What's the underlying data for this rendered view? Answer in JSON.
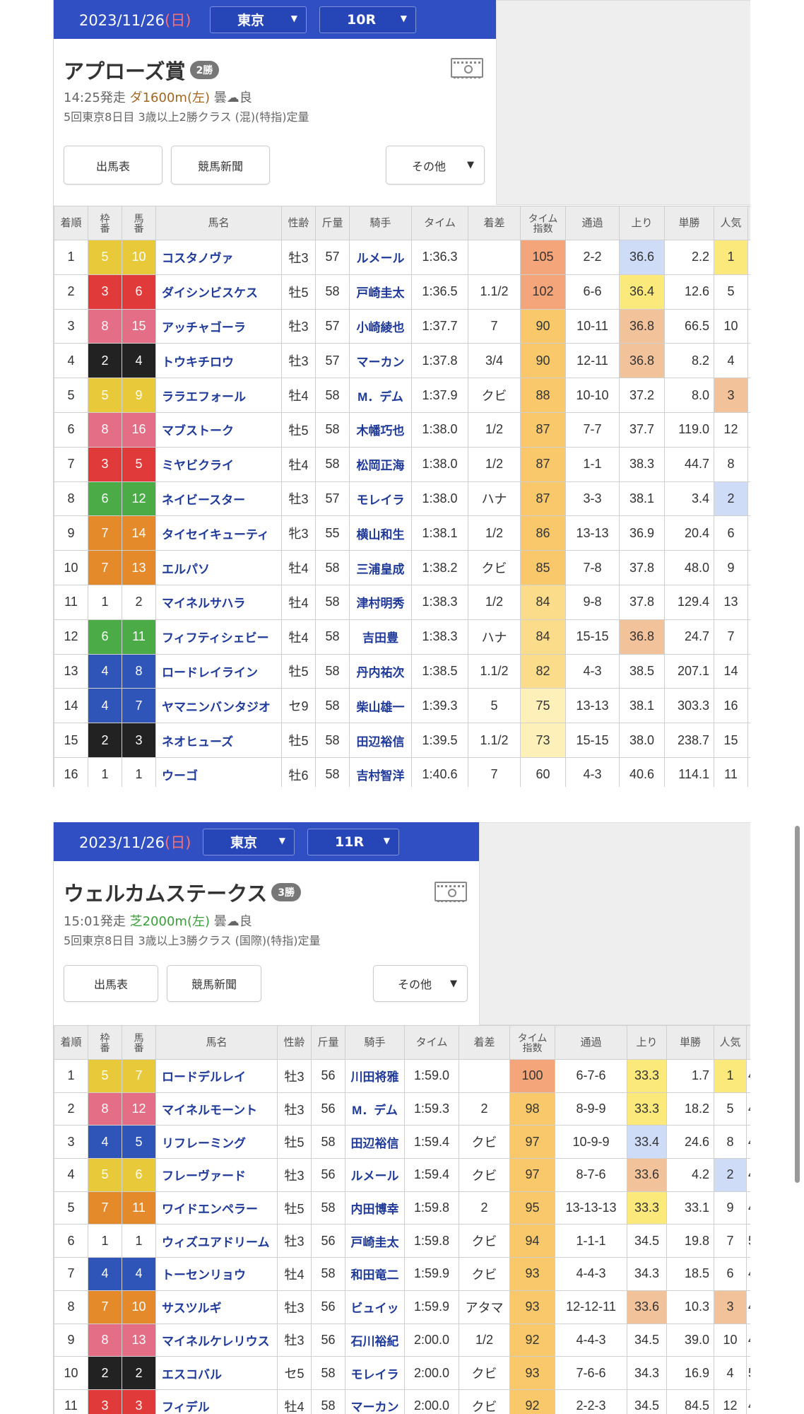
{
  "races": [
    {
      "date": "2023/11/26",
      "dow": "(日)",
      "venue": "東京",
      "race_no": "10R",
      "title": "アプローズ賞",
      "class_badge": "2勝",
      "start": "14:25発走",
      "course": "ダ1600m(左)",
      "surface": "dirt",
      "weather": "曇",
      "track": "良",
      "details": "5回東京8日目 3歳以上2勝クラス (混)(特指)定量",
      "buttons": {
        "entries": "出馬表",
        "newspaper": "競馬新聞",
        "other": "その他"
      },
      "headers": [
        "着順",
        "枠番",
        "馬番",
        "馬名",
        "性齢",
        "斤量",
        "騎手",
        "タイム",
        "着差",
        "タイム指数",
        "通過",
        "上り",
        "単勝",
        "人気"
      ],
      "rows": [
        [
          "1",
          "5",
          "10",
          "コスタノヴァ",
          "牡3",
          "57",
          "ルメール",
          "1:36.3",
          "",
          "105",
          "2-2",
          "36.6",
          "2.2",
          "1"
        ],
        [
          "2",
          "3",
          "6",
          "ダイシンビスケス",
          "牡5",
          "58",
          "戸崎圭太",
          "1:36.5",
          "1.1/2",
          "102",
          "6-6",
          "36.4",
          "12.6",
          "5"
        ],
        [
          "3",
          "8",
          "15",
          "アッチャゴーラ",
          "牡3",
          "57",
          "小崎綾也",
          "1:37.7",
          "7",
          "90",
          "10-11",
          "36.8",
          "66.5",
          "10"
        ],
        [
          "4",
          "2",
          "4",
          "トウキチロウ",
          "牡3",
          "57",
          "マーカン",
          "1:37.8",
          "3/4",
          "90",
          "12-11",
          "36.8",
          "8.2",
          "4"
        ],
        [
          "5",
          "5",
          "9",
          "ララエフォール",
          "牡4",
          "58",
          "M．デム",
          "1:37.9",
          "クビ",
          "88",
          "10-10",
          "37.2",
          "8.0",
          "3"
        ],
        [
          "6",
          "8",
          "16",
          "マブストーク",
          "牡5",
          "58",
          "木幡巧也",
          "1:38.0",
          "1/2",
          "87",
          "7-7",
          "37.7",
          "119.0",
          "12"
        ],
        [
          "7",
          "3",
          "5",
          "ミヤビクライ",
          "牡4",
          "58",
          "松岡正海",
          "1:38.0",
          "1/2",
          "87",
          "1-1",
          "38.3",
          "44.7",
          "8"
        ],
        [
          "8",
          "6",
          "12",
          "ネイビースター",
          "牡3",
          "57",
          "モレイラ",
          "1:38.0",
          "ハナ",
          "87",
          "3-3",
          "38.1",
          "3.4",
          "2"
        ],
        [
          "9",
          "7",
          "14",
          "タイセイキューティ",
          "牝3",
          "55",
          "横山和生",
          "1:38.1",
          "1/2",
          "86",
          "13-13",
          "36.9",
          "20.4",
          "6"
        ],
        [
          "10",
          "7",
          "13",
          "エルパソ",
          "牡4",
          "58",
          "三浦皇成",
          "1:38.2",
          "クビ",
          "85",
          "7-8",
          "37.8",
          "48.0",
          "9"
        ],
        [
          "11",
          "1",
          "2",
          "マイネルサハラ",
          "牡4",
          "58",
          "津村明秀",
          "1:38.3",
          "1/2",
          "84",
          "9-8",
          "37.8",
          "129.4",
          "13"
        ],
        [
          "12",
          "6",
          "11",
          "フィフティシェビー",
          "牡4",
          "58",
          "吉田豊",
          "1:38.3",
          "ハナ",
          "84",
          "15-15",
          "36.8",
          "24.7",
          "7"
        ],
        [
          "13",
          "4",
          "8",
          "ロードレイライン",
          "牡5",
          "58",
          "丹内祐次",
          "1:38.5",
          "1.1/2",
          "82",
          "4-3",
          "38.5",
          "207.1",
          "14"
        ],
        [
          "14",
          "4",
          "7",
          "ヤマニンバンタジオ",
          "セ9",
          "58",
          "柴山雄一",
          "1:39.3",
          "5",
          "75",
          "13-13",
          "38.1",
          "303.3",
          "16"
        ],
        [
          "15",
          "2",
          "3",
          "ネオヒューズ",
          "牡5",
          "58",
          "田辺裕信",
          "1:39.5",
          "1.1/2",
          "73",
          "15-15",
          "38.0",
          "238.7",
          "15"
        ],
        [
          "16",
          "1",
          "1",
          "ウーゴ",
          "牡6",
          "58",
          "吉村智洋",
          "1:40.6",
          "7",
          "60",
          "4-3",
          "40.6",
          "114.1",
          "11"
        ]
      ],
      "agari_hl": {
        "0": "blue",
        "1": "yellow",
        "2": "orange",
        "3": "orange",
        "11": "orange"
      },
      "pop_hl": {
        "0": "yellow",
        "4": "orange",
        "7": "blue"
      },
      "extra_col": [
        "",
        "",
        "",
        "",
        "",
        "",
        "",
        "",
        "",
        "",
        "",
        "",
        "",
        "",
        "",
        ""
      ]
    },
    {
      "date": "2023/11/26",
      "dow": "(日)",
      "venue": "東京",
      "race_no": "11R",
      "title": "ウェルカムステークス",
      "class_badge": "3勝",
      "start": "15:01発走",
      "course": "芝2000m(左)",
      "surface": "turf",
      "weather": "曇",
      "track": "良",
      "details": "5回東京8日目 3歳以上3勝クラス (国際)(特指)定量",
      "buttons": {
        "entries": "出馬表",
        "newspaper": "競馬新聞",
        "other": "その他"
      },
      "headers": [
        "着順",
        "枠番",
        "馬番",
        "馬名",
        "性齢",
        "斤量",
        "騎手",
        "タイム",
        "着差",
        "タイム指数",
        "通過",
        "上り",
        "単勝",
        "人気"
      ],
      "rows": [
        [
          "1",
          "5",
          "7",
          "ロードデルレイ",
          "牡3",
          "56",
          "川田将雅",
          "1:59.0",
          "",
          "100",
          "6-7-6",
          "33.3",
          "1.7",
          "1"
        ],
        [
          "2",
          "8",
          "12",
          "マイネルモーント",
          "牡3",
          "56",
          "M．デム",
          "1:59.3",
          "2",
          "98",
          "8-9-9",
          "33.3",
          "18.2",
          "5"
        ],
        [
          "3",
          "4",
          "5",
          "リフレーミング",
          "牡5",
          "58",
          "田辺裕信",
          "1:59.4",
          "クビ",
          "97",
          "10-9-9",
          "33.4",
          "24.6",
          "8"
        ],
        [
          "4",
          "5",
          "6",
          "フレーヴァード",
          "牡3",
          "56",
          "ルメール",
          "1:59.4",
          "クビ",
          "97",
          "8-7-6",
          "33.6",
          "4.2",
          "2"
        ],
        [
          "5",
          "7",
          "11",
          "ワイドエンペラー",
          "牡5",
          "58",
          "内田博幸",
          "1:59.8",
          "2",
          "95",
          "13-13-13",
          "33.3",
          "33.1",
          "9"
        ],
        [
          "6",
          "1",
          "1",
          "ウィズユアドリーム",
          "牡3",
          "56",
          "戸崎圭太",
          "1:59.8",
          "クビ",
          "94",
          "1-1-1",
          "34.5",
          "19.8",
          "7"
        ],
        [
          "7",
          "4",
          "4",
          "トーセンリョウ",
          "牡4",
          "58",
          "和田竜二",
          "1:59.9",
          "クビ",
          "93",
          "4-4-3",
          "34.3",
          "18.5",
          "6"
        ],
        [
          "8",
          "7",
          "10",
          "サスツルギ",
          "牡3",
          "56",
          "ビュイッ",
          "1:59.9",
          "アタマ",
          "93",
          "12-12-11",
          "33.6",
          "10.3",
          "3"
        ],
        [
          "9",
          "8",
          "13",
          "マイネルケレリウス",
          "牡3",
          "56",
          "石川裕紀",
          "2:00.0",
          "1/2",
          "92",
          "4-4-3",
          "34.5",
          "39.0",
          "10"
        ],
        [
          "10",
          "2",
          "2",
          "エスコバル",
          "セ5",
          "58",
          "モレイラ",
          "2:00.0",
          "クビ",
          "93",
          "7-6-6",
          "34.3",
          "16.9",
          "4"
        ],
        [
          "11",
          "3",
          "3",
          "フィデル",
          "牡4",
          "58",
          "マーカン",
          "2:00.0",
          "クビ",
          "92",
          "2-2-3",
          "34.5",
          "84.5",
          "12"
        ]
      ],
      "agari_hl": {
        "0": "yellow",
        "1": "yellow",
        "2": "blue",
        "3": "orange",
        "4": "yellow",
        "7": "orange"
      },
      "pop_hl": {
        "0": "yellow",
        "3": "blue",
        "7": "orange"
      },
      "extra_col": [
        "4",
        "4",
        "4",
        "4",
        "4",
        "5",
        "4",
        "4",
        "4",
        "5",
        "4"
      ]
    }
  ],
  "colors": {
    "header_blue": "#2f4fc2",
    "waku": {
      "1": "#ffffff",
      "2": "#222222",
      "3": "#e03a3a",
      "4": "#2f55b8",
      "5": "#e8c93a",
      "6": "#4bab47",
      "7": "#e58a2a",
      "8": "#e36e86"
    },
    "hl_yellow": "#fbe97c",
    "hl_blue": "#cfdcf8",
    "hl_orange": "#f2c39a"
  }
}
